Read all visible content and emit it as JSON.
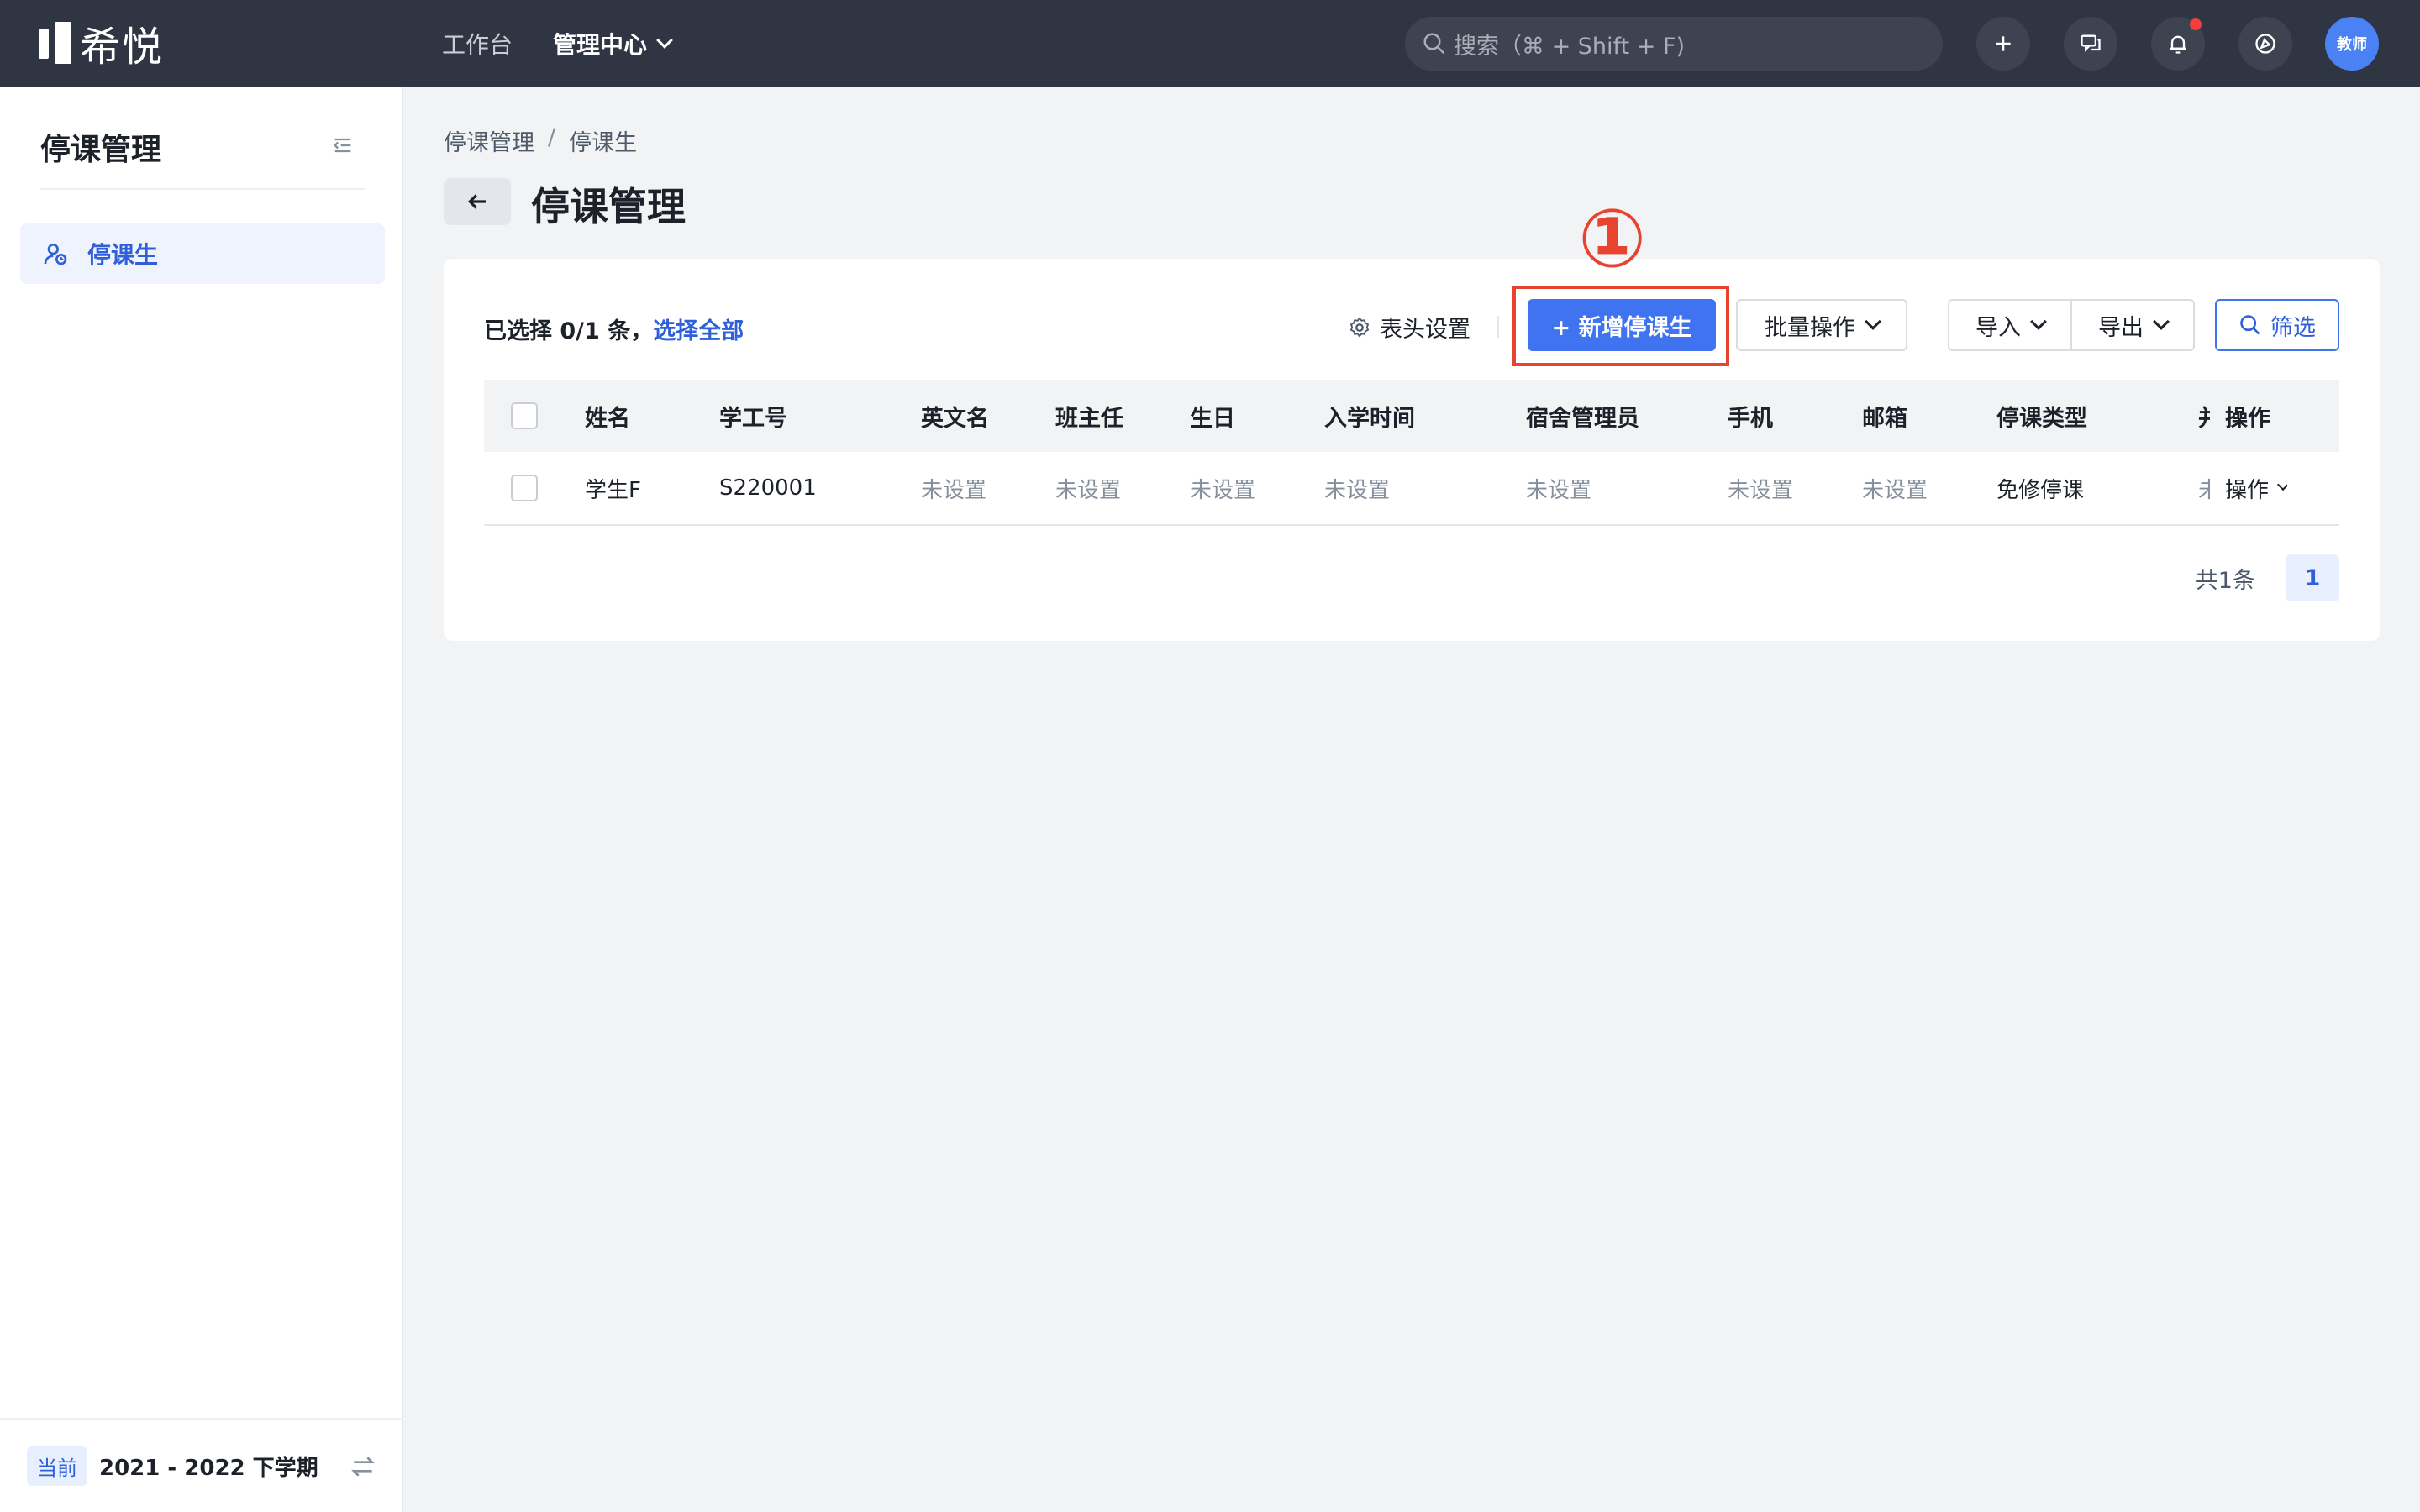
{
  "app": {
    "logo_text": "希悦"
  },
  "topnav": {
    "items": [
      "工作台",
      "管理中心"
    ]
  },
  "search": {
    "placeholder": "搜索（⌘ + Shift + F)"
  },
  "user": {
    "avatar_text": "教师"
  },
  "sidebar": {
    "title": "停课管理",
    "items": [
      {
        "label": "停课生"
      }
    ],
    "footer": {
      "tag": "当前",
      "term": "2021 - 2022 下学期"
    }
  },
  "breadcrumb": [
    "停课管理",
    "停课生"
  ],
  "breadcrumb_sep": "/",
  "page": {
    "title": "停课管理"
  },
  "toolbar": {
    "selection_text": "已选择 0/1 条，",
    "select_all": "选择全部",
    "header_settings": "表头设置",
    "add_button": "+ 新增停课生",
    "batch": "批量操作",
    "import": "导入",
    "export": "导出",
    "filter": "筛选",
    "step_marker": "①"
  },
  "table": {
    "columns": [
      "姓名",
      "学工号",
      "英文名",
      "班主任",
      "生日",
      "入学时间",
      "宿舍管理员",
      "手机",
      "邮箱",
      "停课类型",
      "并",
      "操作"
    ],
    "rows": [
      [
        "学生F",
        "S220001",
        "未设置",
        "未设置",
        "未设置",
        "未设置",
        "未设置",
        "未设置",
        "未设置",
        "免修停课",
        "未",
        "操作"
      ]
    ]
  },
  "pagination": {
    "total": "共1条",
    "current": "1"
  },
  "colors": {
    "accent": "#3f73f0",
    "topbar": "#2f3542",
    "highlight": "#e8432e"
  }
}
